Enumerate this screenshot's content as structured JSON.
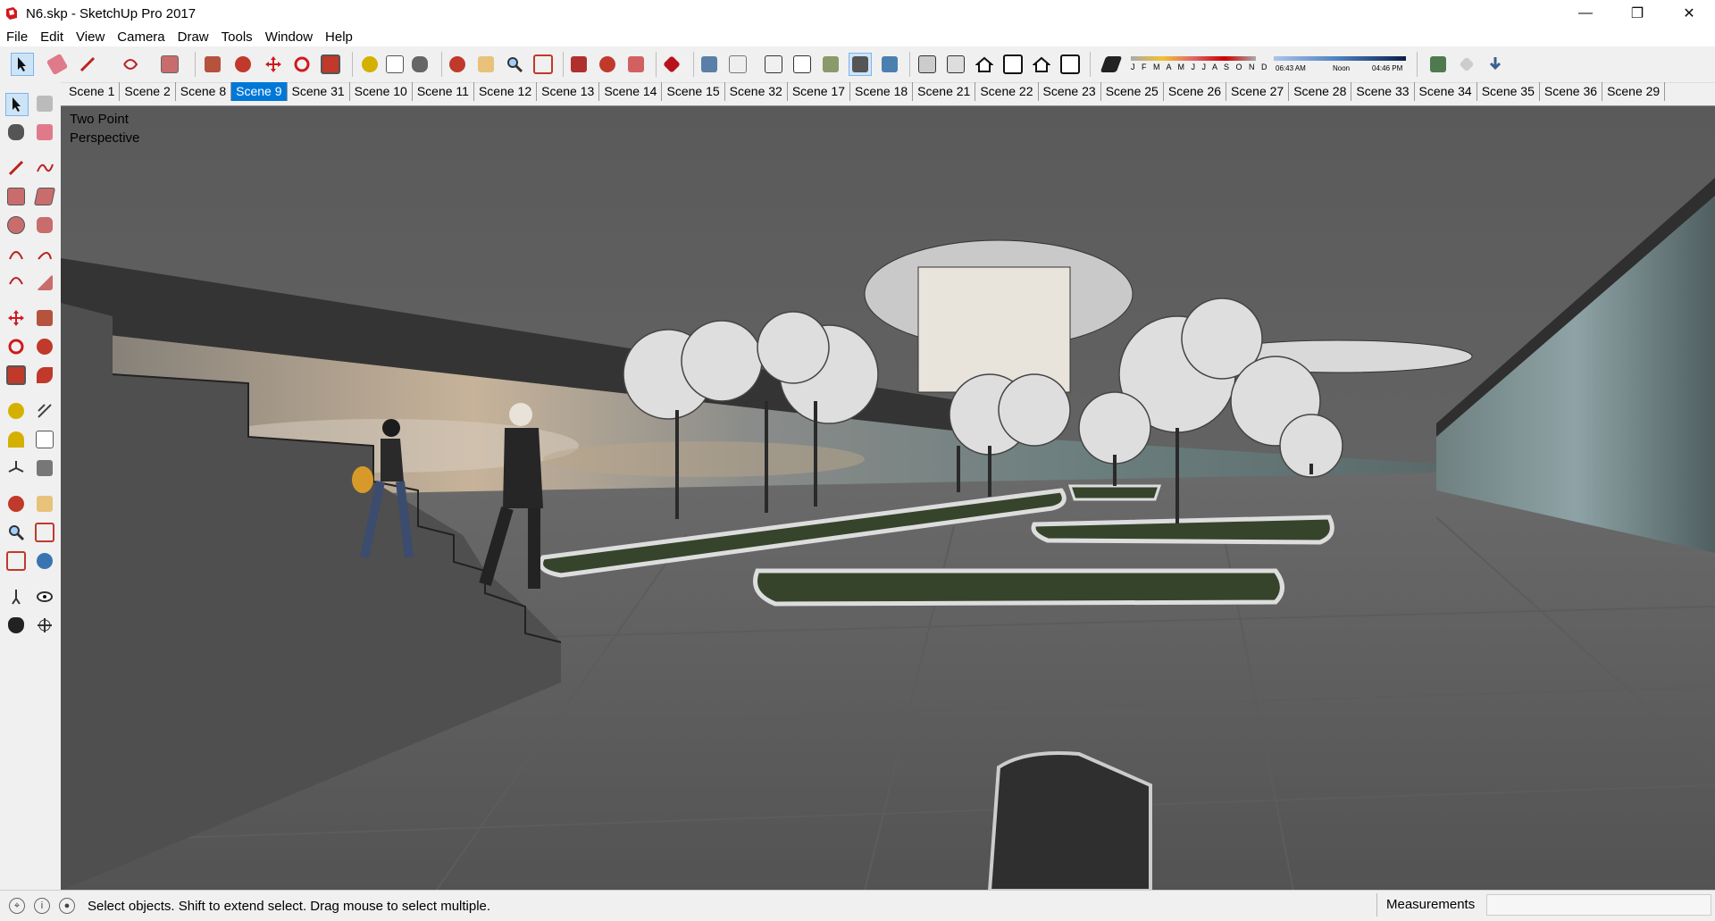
{
  "window": {
    "title": "N6.skp - SketchUp Pro 2017",
    "minimize": "—",
    "maximize": "❐",
    "close": "✕"
  },
  "menu": [
    "File",
    "Edit",
    "View",
    "Camera",
    "Draw",
    "Tools",
    "Window",
    "Help"
  ],
  "toolbar": {
    "shadow_months": "J F M A M J J A S O N D",
    "time_start": "06:43 AM",
    "time_noon": "Noon",
    "time_end": "04:46 PM"
  },
  "scenes": [
    "Scene 1",
    "Scene 2",
    "Scene 8",
    "Scene 9",
    "Scene 31",
    "Scene 10",
    "Scene 11",
    "Scene 12",
    "Scene 13",
    "Scene 14",
    "Scene 15",
    "Scene 32",
    "Scene 17",
    "Scene 18",
    "Scene 21",
    "Scene 22",
    "Scene 23",
    "Scene 25",
    "Scene 26",
    "Scene 27",
    "Scene 28",
    "Scene 33",
    "Scene 34",
    "Scene 35",
    "Scene 36",
    "Scene 29"
  ],
  "active_scene": "Scene 9",
  "viewport": {
    "label_line1": "Two Point",
    "label_line2": "Perspective"
  },
  "status": {
    "message": "Select objects. Shift to extend select. Drag mouse to select multiple.",
    "measurements_label": "Measurements",
    "measurements_value": ""
  },
  "colors": {
    "accent": "#0078d7",
    "floor": "#6f6f6f",
    "planter": "#36442c"
  }
}
